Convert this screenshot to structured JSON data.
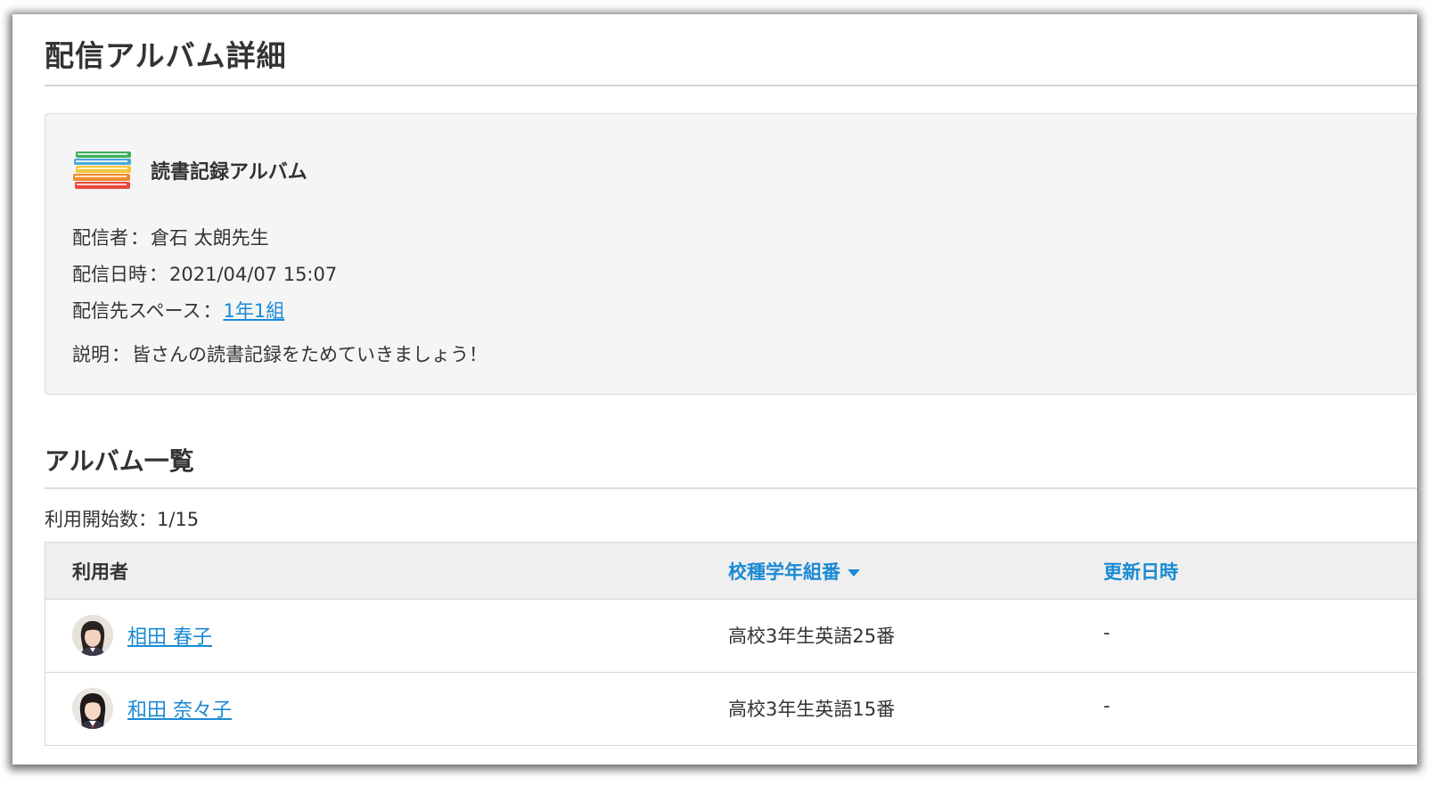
{
  "page": {
    "title": "配信アルバム詳細"
  },
  "album": {
    "icon": "book-stack-icon",
    "name": "読書記録アルバム",
    "sender_label": "配信者",
    "sender": "倉石 太朗先生",
    "date_label": "配信日時",
    "date": "2021/04/07 15:07",
    "space_label": "配信先スペース",
    "space": "1年1組",
    "description_label": "説明",
    "description": "皆さんの読書記録をためていきましょう！",
    "separator": "："
  },
  "list": {
    "title": "アルバム一覧",
    "usage_label": "利用開始数",
    "usage_value": "1/15",
    "columns": {
      "user": "利用者",
      "grade": "校種学年組番",
      "updated": "更新日時"
    },
    "sort": {
      "column": "grade",
      "direction": "descending"
    },
    "rows": [
      {
        "avatar": "student-avatar",
        "name": "相田 春子",
        "grade": "高校3年生英語25番",
        "updated": "-"
      },
      {
        "avatar": "student-avatar",
        "name": "和田 奈々子",
        "grade": "高校3年生英語15番",
        "updated": "-"
      }
    ]
  },
  "colors": {
    "link": "#1a8ad4",
    "panel_bg": "#f5f5f5",
    "table_header_bg": "#efefef",
    "text": "#333333"
  }
}
